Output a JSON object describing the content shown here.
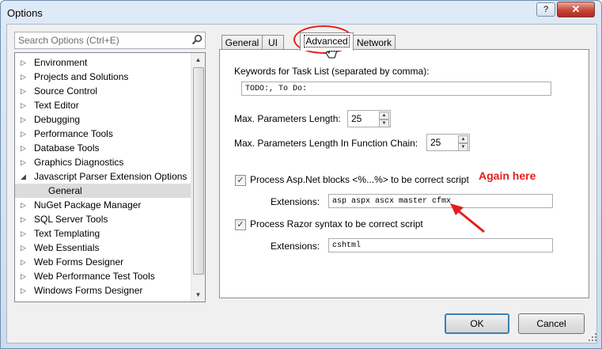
{
  "window": {
    "title": "Options",
    "help_glyph": "?",
    "close_glyph": "✕"
  },
  "search": {
    "placeholder": "Search Options (Ctrl+E)",
    "icon": "search-icon"
  },
  "tree": {
    "items": [
      {
        "label": "Environment",
        "expanded": false
      },
      {
        "label": "Projects and Solutions",
        "expanded": false
      },
      {
        "label": "Source Control",
        "expanded": false
      },
      {
        "label": "Text Editor",
        "expanded": false
      },
      {
        "label": "Debugging",
        "expanded": false
      },
      {
        "label": "Performance Tools",
        "expanded": false
      },
      {
        "label": "Database Tools",
        "expanded": false
      },
      {
        "label": "Graphics Diagnostics",
        "expanded": false
      },
      {
        "label": "Javascript Parser Extension Options",
        "expanded": true
      },
      {
        "label": "General",
        "child": true,
        "selected": true
      },
      {
        "label": "NuGet Package Manager",
        "expanded": false
      },
      {
        "label": "SQL Server Tools",
        "expanded": false
      },
      {
        "label": "Text Templating",
        "expanded": false
      },
      {
        "label": "Web Essentials",
        "expanded": false
      },
      {
        "label": "Web Forms Designer",
        "expanded": false
      },
      {
        "label": "Web Performance Test Tools",
        "expanded": false
      },
      {
        "label": "Windows Forms Designer",
        "expanded": false
      }
    ]
  },
  "tabs": [
    {
      "label": "General"
    },
    {
      "label": "UI"
    },
    {
      "label": "Advanced",
      "active": true
    },
    {
      "label": "Network"
    }
  ],
  "advanced": {
    "keywords_label": "Keywords for Task List (separated by comma):",
    "keywords_value": "TODO:, To Do:",
    "max_params_label": "Max. Parameters Length:",
    "max_params_value": "25",
    "max_params_chain_label": "Max. Parameters Length In Function Chain:",
    "max_params_chain_value": "25",
    "aspnet_checkbox_label": "Process Asp.Net blocks <%...%> to be correct script",
    "aspnet_checked": true,
    "aspnet_ext_label": "Extensions:",
    "aspnet_ext_value": "asp aspx ascx master cfmx",
    "razor_checkbox_label": "Process Razor syntax to be correct script",
    "razor_checked": true,
    "razor_ext_label": "Extensions:",
    "razor_ext_value": "cshtml"
  },
  "annotation": {
    "text": "Again here",
    "color": "#e41e1e"
  },
  "buttons": {
    "ok": "OK",
    "cancel": "Cancel"
  }
}
